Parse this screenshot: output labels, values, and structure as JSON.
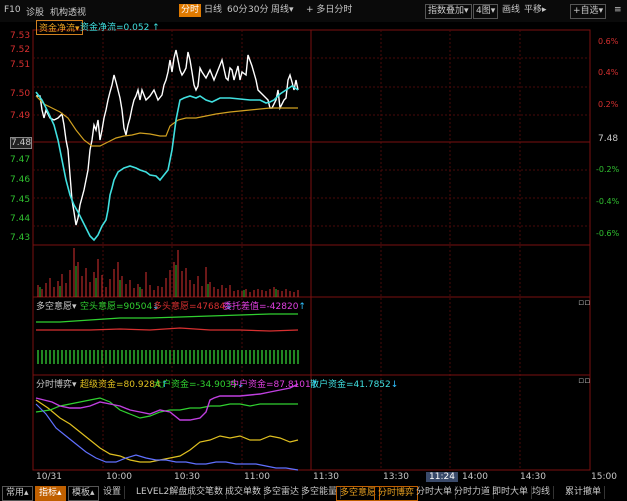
{
  "topbar": {
    "left_items": [
      "F10",
      "诊股",
      "机构透视"
    ],
    "tabs": [
      "分时",
      "日线",
      "60分",
      "30分",
      "周线"
    ],
    "active_tab": "分时",
    "multi_day": "多日分时",
    "right_items": [
      "指数叠加",
      "4图",
      "画线",
      "平移",
      "自选"
    ]
  },
  "main": {
    "indicator": "资金净流",
    "indicator_value": "资金净流=0.052",
    "y_left": [
      "7.53",
      "7.52",
      "7.51",
      "7.50",
      "7.49",
      "7.48",
      "7.47",
      "7.46",
      "7.45",
      "7.44",
      "7.43"
    ],
    "y_right": [
      "0.6%",
      "0.4%",
      "0.2%",
      "7.48",
      "-0.2%",
      "-0.4%",
      "-0.6%"
    ],
    "chart_data": {
      "type": "line",
      "x_start": "09:30",
      "ylim": [
        7.43,
        7.53
      ],
      "series": [
        {
          "name": "",
          "color": "#ffffff",
          "values": [
            7.5,
            7.495,
            7.49,
            7.48,
            7.46,
            7.44,
            7.45,
            7.47,
            7.49,
            7.5,
            7.49,
            7.5,
            7.52,
            7.51,
            7.52,
            7.51,
            7.5,
            7.51,
            7.5,
            7.49,
            7.5
          ]
        },
        {
          "name": "",
          "color": "#d0a020",
          "values": [
            7.5,
            7.495,
            7.49,
            7.485,
            7.478,
            7.476,
            7.477,
            7.479,
            7.482,
            7.485,
            7.487,
            7.489,
            7.491,
            7.492,
            7.493,
            7.494,
            7.494,
            7.494,
            7.495,
            7.495,
            7.495
          ]
        }
      ]
    }
  },
  "panel2": {
    "title": "多空意愿",
    "v1_label": "空头意愿=90504",
    "v2_label": "多头意愿=47684",
    "v3_label": "委托差值=-42820"
  },
  "panel3": {
    "title": "分时博弈",
    "v1_label": "超级资金=80.9284",
    "v2_label": "大户资金=-34.9035",
    "v3_label": "中户资金=87.8101",
    "v4_label": "散户资金=41.7852"
  },
  "xaxis": {
    "labels": [
      "10/31",
      "10:00",
      "10:30",
      "11:00",
      "11:30",
      "13:30",
      "14:00",
      "14:30",
      "15:00"
    ],
    "cursor_time": "11:24"
  },
  "bottom_tabs": [
    "常用",
    "指标",
    "模板",
    "设置",
    "LEVEL2解盘",
    "成交笔数",
    "成交单数",
    "多空雷达",
    "多空能量",
    "多空意愿",
    "分时博弈",
    "分时大单",
    "分时力道",
    "即时大单",
    "均线",
    "累计撤单"
  ],
  "active_bottom_tabs": [
    "指标",
    "多空意愿",
    "分时博弈"
  ],
  "colors": {
    "up": "#d83030",
    "down": "#30c030",
    "accent": "#e07a00",
    "cyan": "#40e0e0",
    "yellow": "#e0c020",
    "magenta": "#e040e0"
  }
}
